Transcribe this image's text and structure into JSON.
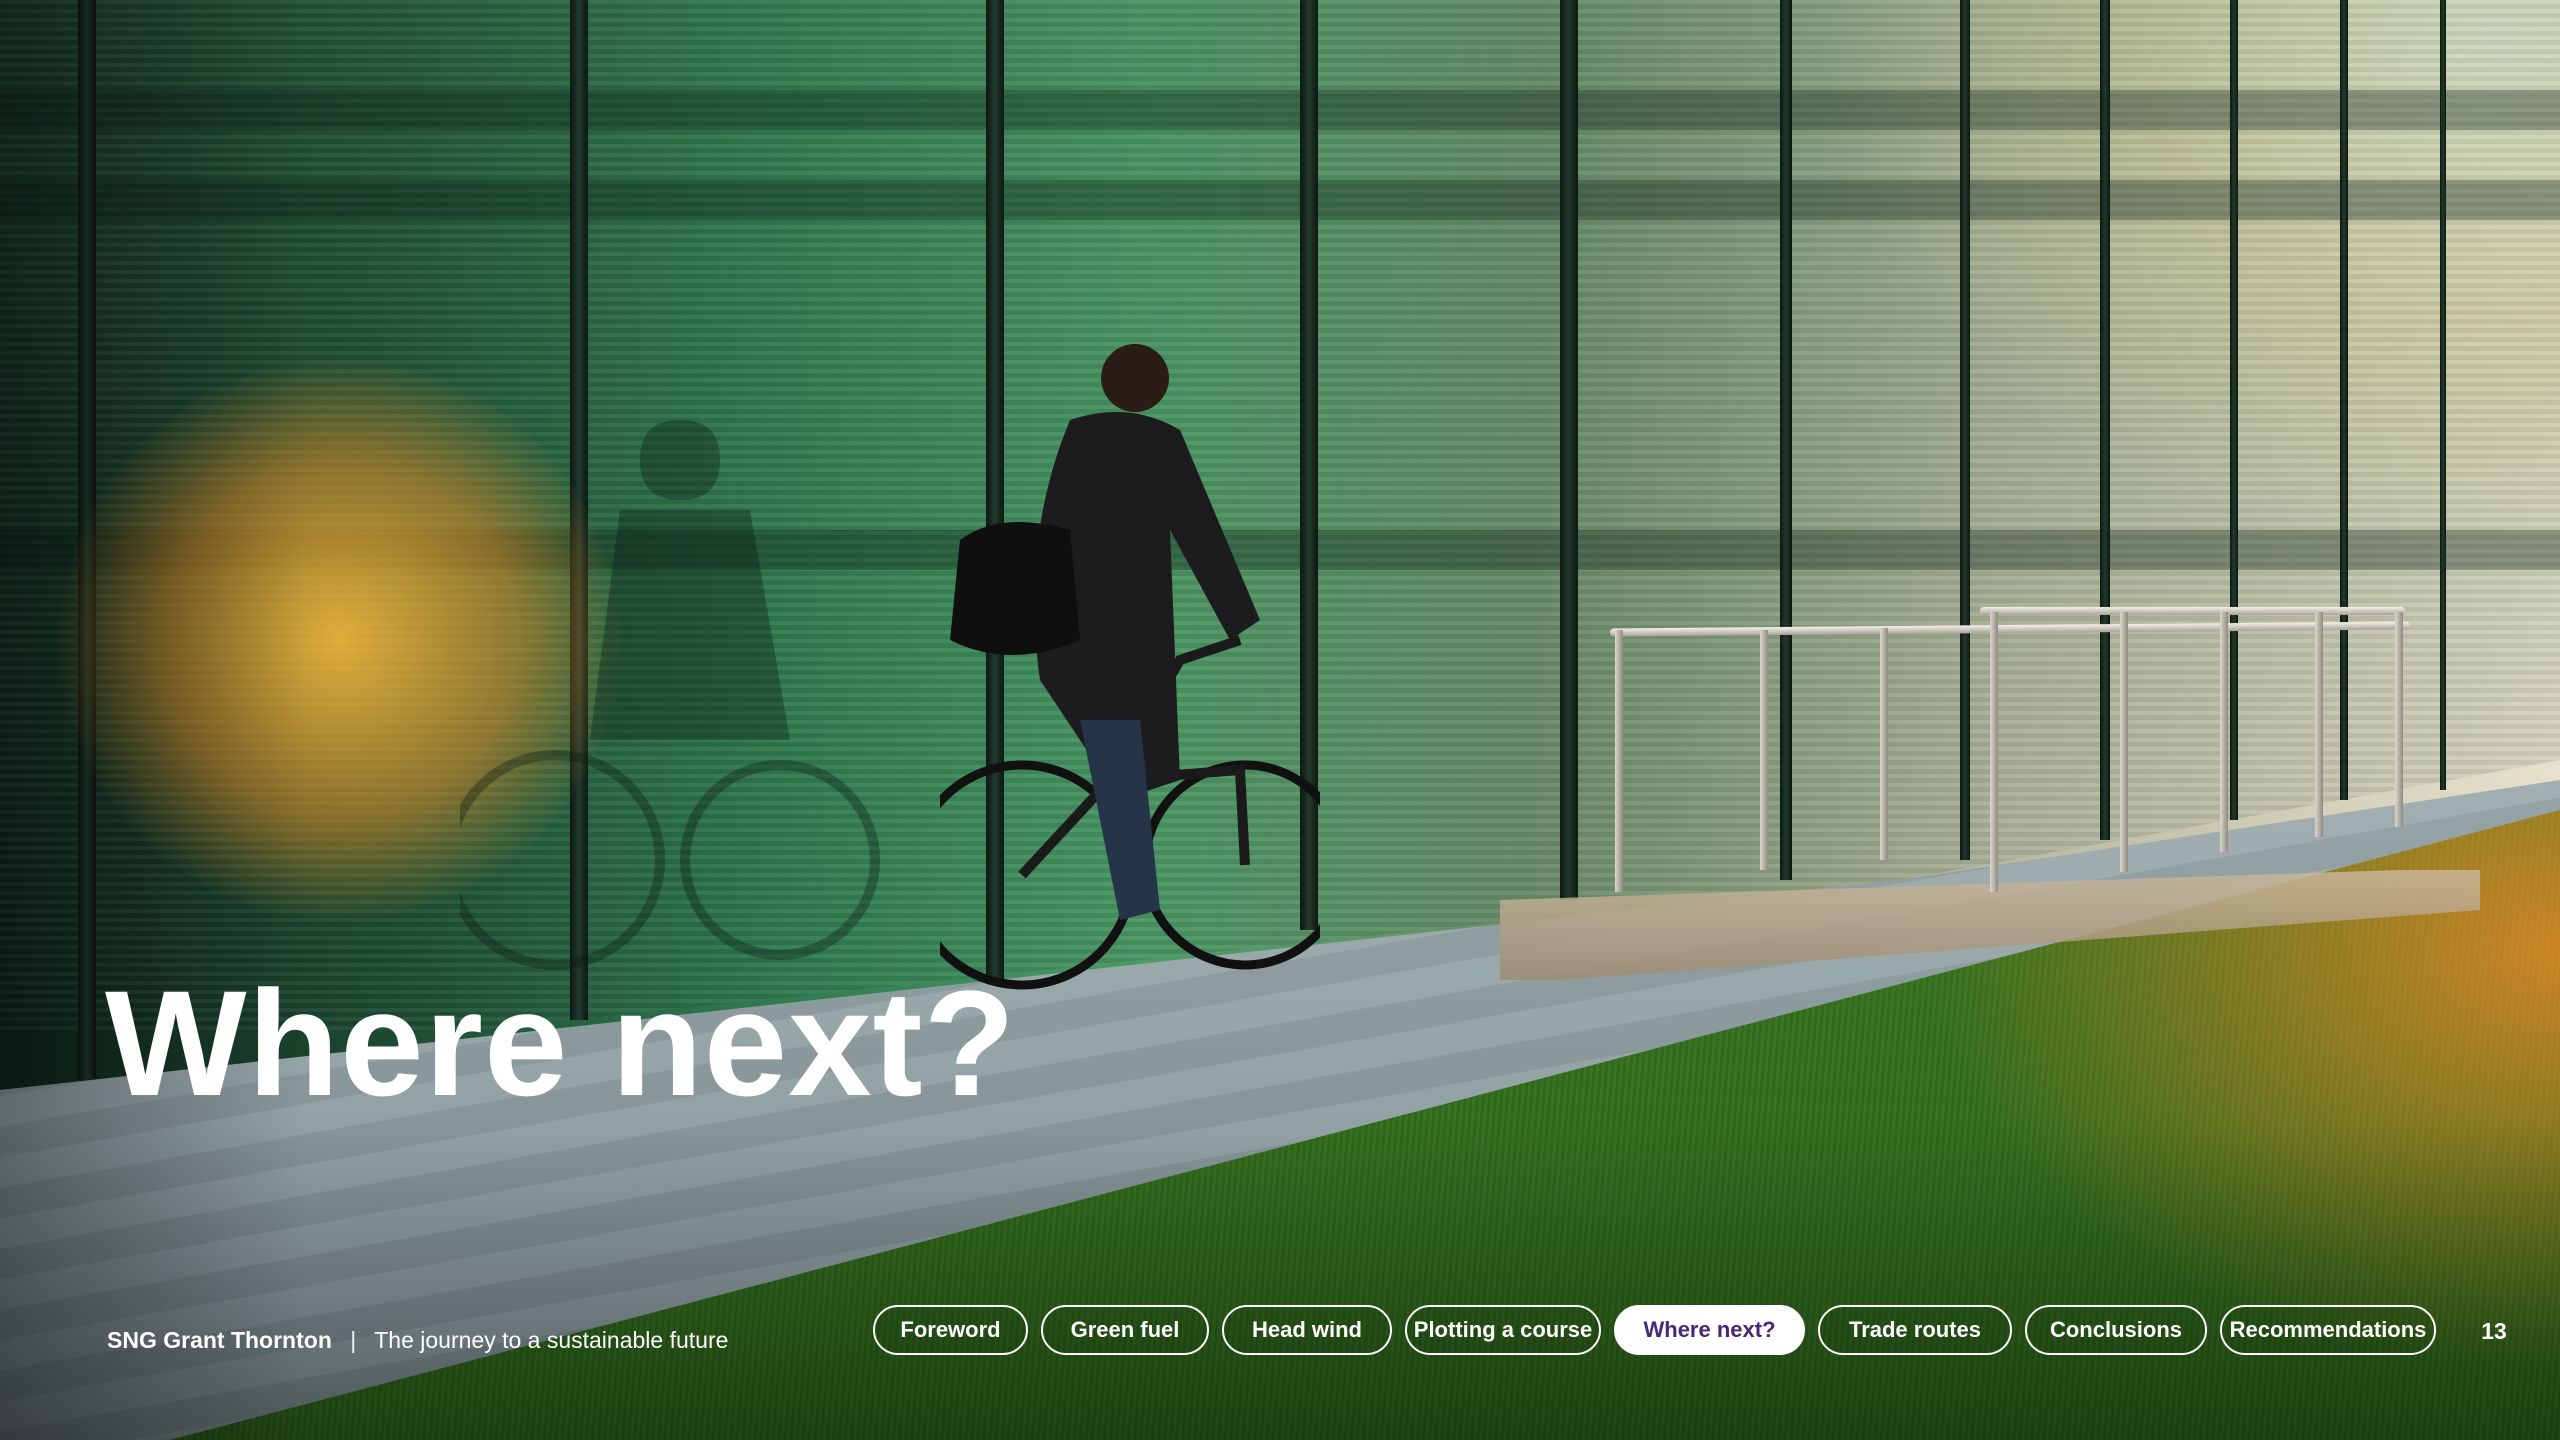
{
  "slide": {
    "title": "Where next?"
  },
  "footer": {
    "brand": "SNG Grant Thornton",
    "separator": "|",
    "subtitle": "The journey to a sustainable future"
  },
  "nav": {
    "tabs": [
      {
        "label": "Foreword"
      },
      {
        "label": "Green fuel"
      },
      {
        "label": "Head wind"
      },
      {
        "label": "Plotting a course"
      },
      {
        "label": "Where next?"
      },
      {
        "label": "Trade routes"
      },
      {
        "label": "Conclusions"
      },
      {
        "label": "Recommendations"
      }
    ],
    "active_index": 4,
    "active_text_color": "#4b2577"
  },
  "page_number": "13"
}
